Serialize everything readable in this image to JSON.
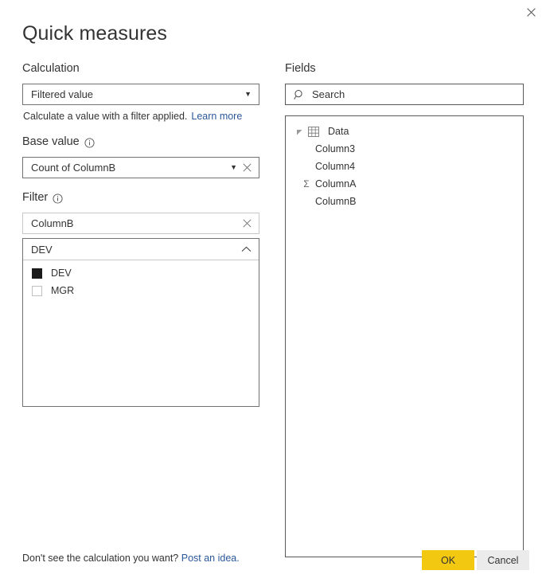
{
  "dialog": {
    "title": "Quick measures",
    "close_icon": "close-icon"
  },
  "calculation": {
    "label": "Calculation",
    "selected": "Filtered value",
    "caret_icon": "chevron-down-icon",
    "description": "Calculate a value with a filter applied.",
    "learn_more": "Learn more"
  },
  "base_value": {
    "label": "Base value",
    "info_icon": "info-icon",
    "value": "Count of ColumnB",
    "dropdown_icon": "chevron-down-icon",
    "clear_icon": "close-icon"
  },
  "filter": {
    "label": "Filter",
    "info_icon": "info-icon",
    "field_value": "ColumnB",
    "field_clear_icon": "close-icon",
    "combo": {
      "selected": "DEV",
      "chevron_icon": "chevron-up-icon",
      "items": [
        {
          "label": "DEV",
          "checked": true
        },
        {
          "label": "MGR",
          "checked": false
        }
      ]
    }
  },
  "fields": {
    "label": "Fields",
    "search": {
      "placeholder": "Search",
      "value": "Search",
      "icon": "search-icon"
    },
    "tree": {
      "table": {
        "name": "Data",
        "expander_icon": "triangle-expanded-icon",
        "table_icon": "table-icon",
        "expanded": true
      },
      "columns": [
        {
          "name": "Column3",
          "aggregate": false
        },
        {
          "name": "Column4",
          "aggregate": false
        },
        {
          "name": "ColumnA",
          "aggregate": true,
          "aggregate_icon": "sigma-icon"
        },
        {
          "name": "ColumnB",
          "aggregate": false
        }
      ]
    }
  },
  "footer": {
    "note_prefix": "Don't see the calculation you want?",
    "post_link": "Post an idea.",
    "ok_label": "OK",
    "cancel_label": "Cancel"
  },
  "colors": {
    "accent_yellow": "#f2c811",
    "link_blue": "#2b579a",
    "cancel_gray": "#ebebeb",
    "text": "#333333",
    "border": "#727272"
  }
}
